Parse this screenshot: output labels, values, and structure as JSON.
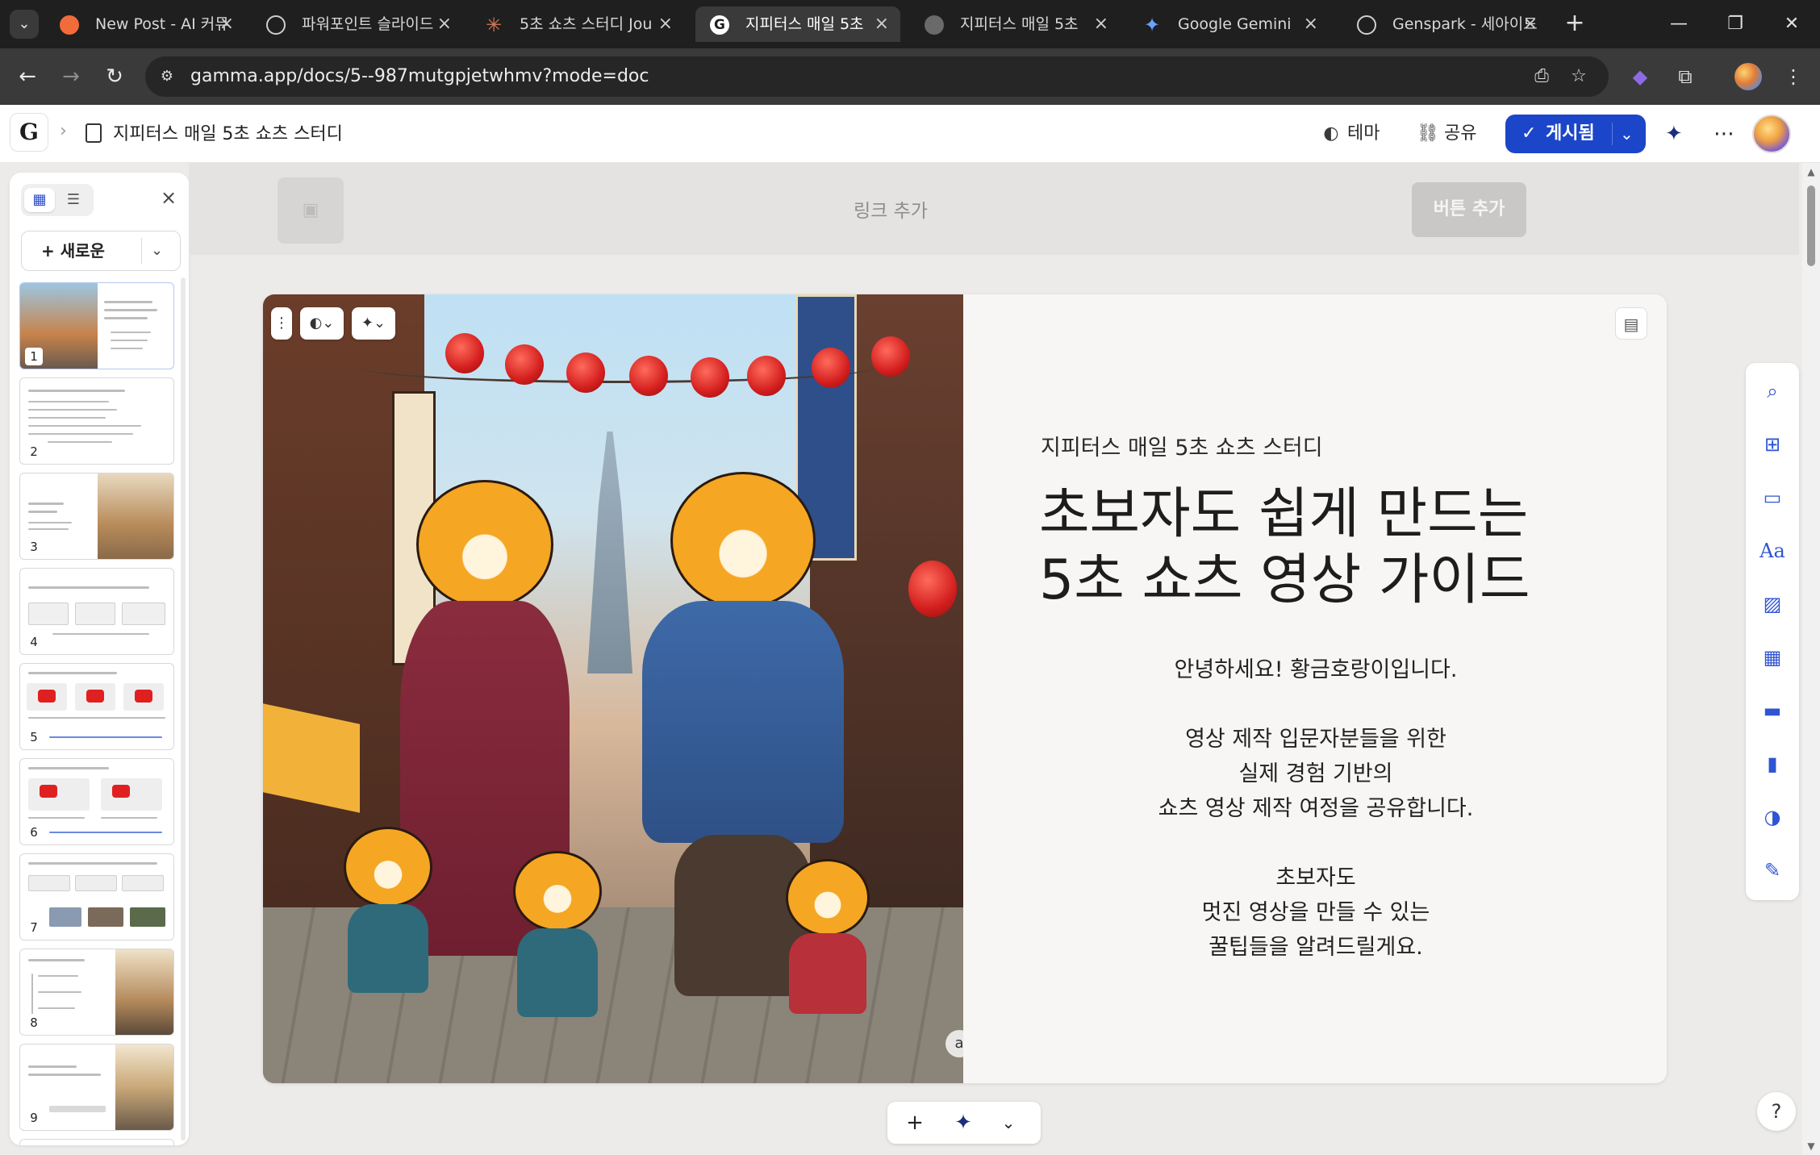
{
  "browser": {
    "tabs": [
      {
        "title": "New Post - AI 커뮤",
        "favicon": "orange-circle-icon",
        "active": false
      },
      {
        "title": "파워포인트 슬라이드",
        "favicon": "openai-icon",
        "active": false
      },
      {
        "title": "5초 쇼츠 스터디 Jou",
        "favicon": "claude-icon",
        "active": false
      },
      {
        "title": "지피터스 매일 5초",
        "favicon": "gamma-g-icon",
        "active": true
      },
      {
        "title": "지피터스 매일 5초",
        "favicon": "globe-icon",
        "active": false
      },
      {
        "title": "Google Gemini",
        "favicon": "gemini-icon",
        "active": false
      },
      {
        "title": "Genspark - 세아이드",
        "favicon": "genspark-icon",
        "active": false
      }
    ],
    "url": "gamma.app/docs/5--987mutgpjetwhmv?mode=doc"
  },
  "app": {
    "doc_title": "지피터스 매일 5초 쇼츠 스터디",
    "theme_label": "테마",
    "share_label": "공유",
    "publish_label": "게시됨"
  },
  "sidebar": {
    "new_label": "새로운",
    "slide_numbers": [
      "1",
      "2",
      "3",
      "4",
      "5",
      "6",
      "7",
      "8",
      "9"
    ]
  },
  "topbar": {
    "link_placeholder": "링크 추가",
    "button_placeholder": "버튼 추가"
  },
  "card": {
    "subtitle": "지피터스 매일 5초 쇼츠 스터디",
    "title_line1": "초보자도 쉽게 만드는",
    "title_line2": "5초 쇼츠 영상 가이드",
    "greeting": "안녕하세요! 황금호랑이입니다.",
    "para2_line1": "영상 제작 입문자분들을 위한",
    "para2_line2": "실제 경험 기반의",
    "para2_line3": "쇼츠 영상 제작 여정을 공유합니다.",
    "para3_line1": "초보자도",
    "para3_line2": "멋진 영상을 만들 수 있는",
    "para3_line3": "꿀팁들을 알려드릴게요."
  },
  "colors": {
    "accent": "#1c46c9",
    "rail_icon": "#2f55d4"
  },
  "help_label": "?"
}
